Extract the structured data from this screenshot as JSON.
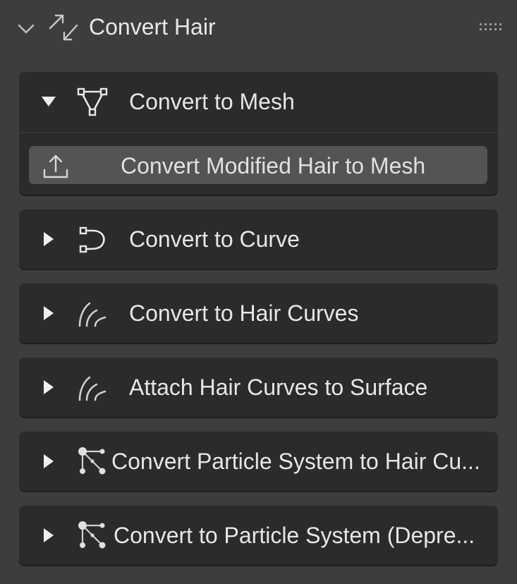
{
  "panel": {
    "title": "Convert Hair",
    "icons": {
      "collapse": "chevron-down-icon",
      "main": "convert-arrows-icon",
      "grip": "drag-grip-icon"
    }
  },
  "subpanels": [
    {
      "label": "Convert to Mesh",
      "expanded": true,
      "icon": "mesh-triangle-icon",
      "operator": {
        "label": "Convert Modified Hair to Mesh",
        "icon": "export-upload-icon"
      }
    },
    {
      "label": "Convert to Curve",
      "expanded": false,
      "icon": "curve-bezier-icon"
    },
    {
      "label": "Convert to Hair Curves",
      "expanded": false,
      "icon": "hair-curves-icon"
    },
    {
      "label": "Attach Hair Curves to Surface",
      "expanded": false,
      "icon": "hair-curves-icon"
    },
    {
      "label": "Convert Particle System to Hair Cu...",
      "expanded": false,
      "icon": "particles-icon"
    },
    {
      "label": "Convert to Particle System (Depre...",
      "expanded": false,
      "icon": "particles-icon"
    }
  ],
  "colors": {
    "background": "#3d3d3d",
    "subpanel": "#2b2b2b",
    "button": "#545454",
    "text": "#e6e6e6"
  }
}
